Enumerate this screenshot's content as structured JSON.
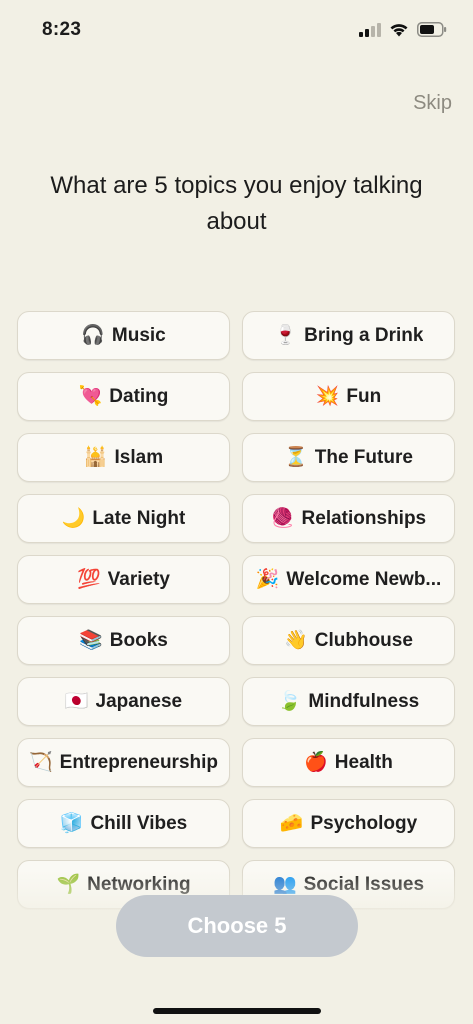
{
  "status_bar": {
    "time": "8:23",
    "icons": [
      "cellular-signal-icon",
      "wifi-icon",
      "battery-icon"
    ]
  },
  "skip_label": "Skip",
  "heading": "What are 5 topics you enjoy talking about",
  "topics": [
    {
      "emoji": "🎧",
      "label": "Music"
    },
    {
      "emoji": "🍷",
      "label": "Bring a Drink"
    },
    {
      "emoji": "💘",
      "label": "Dating"
    },
    {
      "emoji": "💥",
      "label": "Fun"
    },
    {
      "emoji": "🕌",
      "label": "Islam"
    },
    {
      "emoji": "⏳",
      "label": "The Future"
    },
    {
      "emoji": "🌙",
      "label": "Late Night"
    },
    {
      "emoji": "🧶",
      "label": "Relationships"
    },
    {
      "emoji": "💯",
      "label": "Variety"
    },
    {
      "emoji": "🎉",
      "label": "Welcome Newb..."
    },
    {
      "emoji": "📚",
      "label": "Books"
    },
    {
      "emoji": "👋",
      "label": "Clubhouse"
    },
    {
      "emoji": "🇯🇵",
      "label": "Japanese"
    },
    {
      "emoji": "🍃",
      "label": "Mindfulness"
    },
    {
      "emoji": "🏹",
      "label": "Entrepreneurship"
    },
    {
      "emoji": "🍎",
      "label": "Health"
    },
    {
      "emoji": "🧊",
      "label": "Chill Vibes"
    },
    {
      "emoji": "🧀",
      "label": "Psychology"
    },
    {
      "emoji": "🌱",
      "label": "Networking"
    },
    {
      "emoji": "👥",
      "label": "Social Issues"
    }
  ],
  "choose_button_label": "Choose 5",
  "colors": {
    "background": "#f2f0e5",
    "chip_background": "#faf9f4",
    "button_disabled": "#c4c9cf",
    "skip_text": "#8d8a80"
  }
}
